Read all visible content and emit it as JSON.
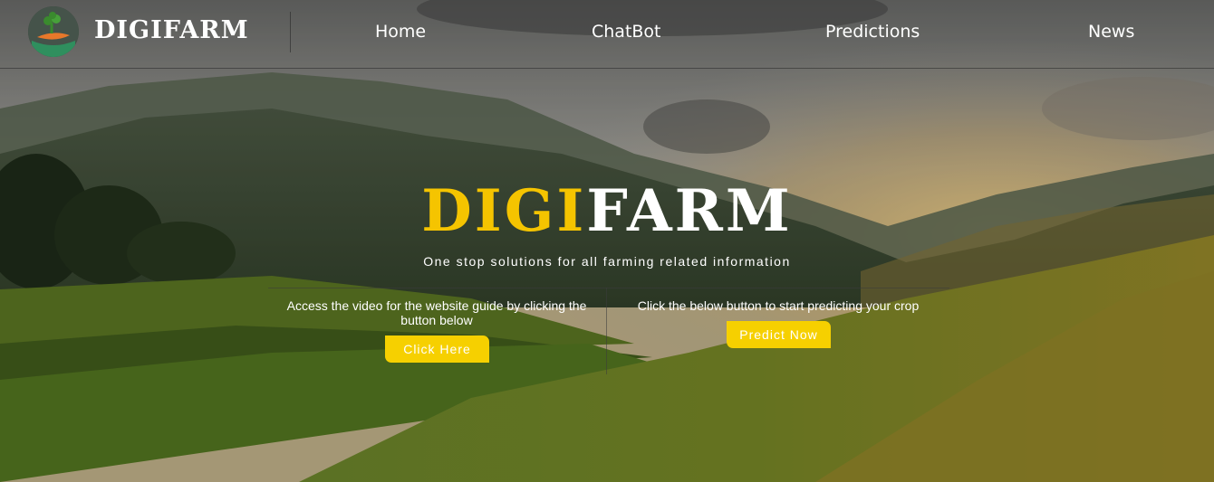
{
  "brand": {
    "name": "DIGIFARM"
  },
  "nav": {
    "links": [
      "Home",
      "ChatBot",
      "Predictions",
      "News"
    ]
  },
  "hero": {
    "title_part1": "DIGI",
    "title_part2": "FARM",
    "subtitle": "One stop solutions for all farming related information",
    "left_text": "Access the video for the website guide by clicking the button below",
    "left_button": "Click Here",
    "right_text": "Click the below button to start predicting your crop",
    "right_button": "Predict Now"
  },
  "colors": {
    "accent": "#f5c400",
    "button": "#f6d000",
    "text": "#ffffff"
  }
}
